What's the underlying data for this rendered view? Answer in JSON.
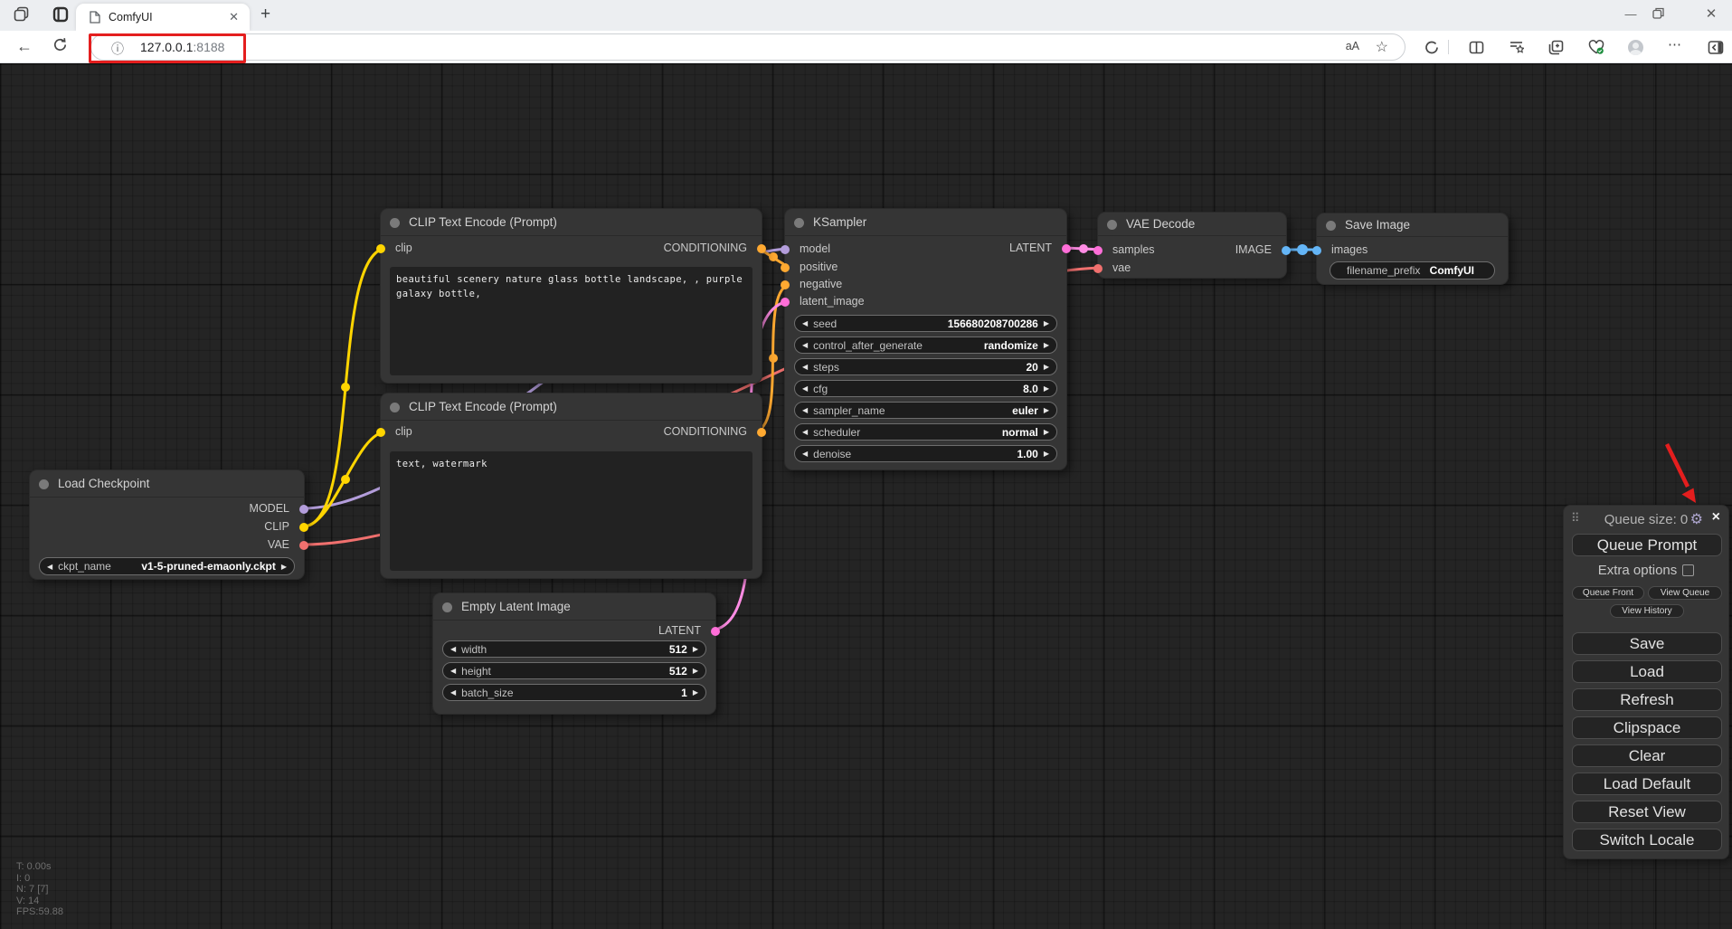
{
  "browser": {
    "tab_title": "ComfyUI",
    "url": {
      "host": "127.0.0.1",
      "port": ":8188"
    }
  },
  "nodes": {
    "load_checkpoint": {
      "title": "Load Checkpoint",
      "outputs": [
        "MODEL",
        "CLIP",
        "VAE"
      ],
      "widgets": [
        {
          "label": "ckpt_name",
          "value": "v1-5-pruned-emaonly.ckpt"
        }
      ]
    },
    "clip_encode_positive": {
      "title": "CLIP Text Encode (Prompt)",
      "inputs": [
        "clip"
      ],
      "outputs": [
        "CONDITIONING"
      ],
      "text": "beautiful scenery nature glass bottle landscape, , purple galaxy bottle,"
    },
    "clip_encode_negative": {
      "title": "CLIP Text Encode (Prompt)",
      "inputs": [
        "clip"
      ],
      "outputs": [
        "CONDITIONING"
      ],
      "text": "text, watermark"
    },
    "empty_latent": {
      "title": "Empty Latent Image",
      "outputs": [
        "LATENT"
      ],
      "widgets": [
        {
          "label": "width",
          "value": "512"
        },
        {
          "label": "height",
          "value": "512"
        },
        {
          "label": "batch_size",
          "value": "1"
        }
      ]
    },
    "ksampler": {
      "title": "KSampler",
      "inputs": [
        "model",
        "positive",
        "negative",
        "latent_image"
      ],
      "outputs": [
        "LATENT"
      ],
      "widgets": [
        {
          "label": "seed",
          "value": "156680208700286"
        },
        {
          "label": "control_after_generate",
          "value": "randomize"
        },
        {
          "label": "steps",
          "value": "20"
        },
        {
          "label": "cfg",
          "value": "8.0"
        },
        {
          "label": "sampler_name",
          "value": "euler"
        },
        {
          "label": "scheduler",
          "value": "normal"
        },
        {
          "label": "denoise",
          "value": "1.00"
        }
      ]
    },
    "vae_decode": {
      "title": "VAE Decode",
      "inputs": [
        "samples",
        "vae"
      ],
      "outputs": [
        "IMAGE"
      ]
    },
    "save_image": {
      "title": "Save Image",
      "inputs": [
        "images"
      ],
      "widgets": [
        {
          "label": "filename_prefix",
          "value": "ComfyUI"
        }
      ]
    }
  },
  "queue_panel": {
    "title": "Queue size: 0",
    "queue_prompt": "Queue Prompt",
    "extra_options": "Extra options",
    "small_buttons": [
      "Queue Front",
      "View Queue",
      "View History"
    ],
    "big_buttons": [
      "Save",
      "Load",
      "Refresh",
      "Clipspace",
      "Clear",
      "Load Default",
      "Reset View",
      "Switch Locale"
    ]
  },
  "stats": {
    "lines": [
      "T: 0.00s",
      "I: 0",
      "N: 7 [7]",
      "V: 14",
      "FPS:59.88"
    ]
  },
  "colors": {
    "model": "#b39ddb",
    "clip": "#ffd500",
    "vae": "#f0706e",
    "conditioning": "#ffa931",
    "latent": "#ff6ed8",
    "image": "#64b5f6",
    "annotation": "#e41e1e"
  }
}
